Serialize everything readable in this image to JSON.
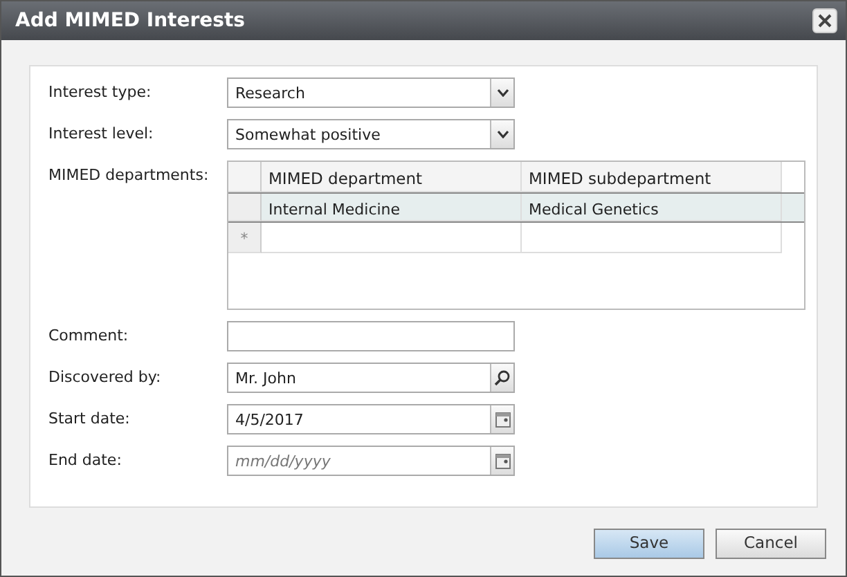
{
  "window": {
    "title": "Add MIMED Interests"
  },
  "fields": [
    {
      "kind": "select",
      "label": "Interest type:",
      "value": "Research"
    },
    {
      "kind": "select",
      "label": "Interest level:",
      "value": "Somewhat positive"
    },
    {
      "kind": "grid",
      "label": "MIMED departments:",
      "columns": [
        "MIMED department",
        "MIMED subdepartment"
      ],
      "rows": [
        {
          "cells": [
            "Internal Medicine",
            "Medical Genetics"
          ],
          "selected": true
        }
      ],
      "new_row_marker": "*"
    },
    {
      "kind": "text",
      "label": "Comment:"
    },
    {
      "kind": "lookup",
      "label": "Discovered by:",
      "value": "Mr. John"
    },
    {
      "kind": "date",
      "label": "Start date:",
      "value": "4/5/2017"
    },
    {
      "kind": "date",
      "label": "End date:",
      "placeholder": "mm/dd/yyyy"
    }
  ],
  "buttons": [
    {
      "label": "Save",
      "kind": "primary"
    },
    {
      "label": "Cancel",
      "kind": "default"
    }
  ]
}
